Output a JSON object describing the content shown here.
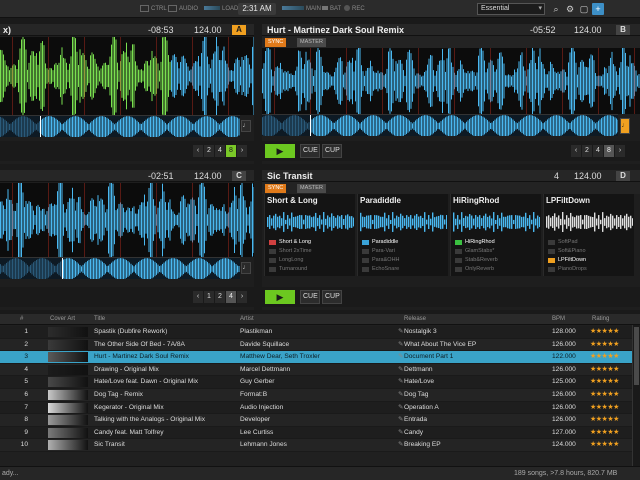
{
  "header": {
    "ctrl_label": "CTRL",
    "audio_label": "AUDIO",
    "load_label": "LOAD",
    "clock": "2:31 AM",
    "main_label": "MAIN",
    "bat_label": "BAT",
    "rec_label": "REC",
    "layout": "Essential"
  },
  "deck_a": {
    "title": "x)",
    "time": "-08:53",
    "bpm": "124.00",
    "letter": "A",
    "loop": [
      "2",
      "4",
      "8"
    ],
    "loop_active": "8"
  },
  "deck_b": {
    "title": "Hurt - Martinez Dark Soul Remix",
    "sync": "SYNC",
    "master": "MASTER",
    "time": "-05:52",
    "bpm": "124.00",
    "letter": "B",
    "play": "▶",
    "cue": "CUE",
    "cup": "CUP",
    "loop": [
      "2",
      "4",
      "8"
    ],
    "loop_active": "8"
  },
  "deck_c": {
    "time": "-02:51",
    "bpm": "124.00",
    "letter": "C",
    "loop": [
      "1",
      "2",
      "4"
    ],
    "loop_active": "4"
  },
  "deck_d": {
    "title": "Sic Transit",
    "sync": "SYNC",
    "master": "MASTER",
    "counter": "4",
    "bpm": "124.00",
    "letter": "D",
    "play": "▶",
    "cue": "CUE",
    "cup": "CUP",
    "slots": [
      {
        "title": "Short & Long",
        "items": [
          "Short & Long",
          "Short 2xTime",
          "LongLong",
          "Turnaround"
        ],
        "active": 0,
        "color": "#d04040"
      },
      {
        "title": "Paradiddle",
        "items": [
          "Paradiddle",
          "Para-Vari",
          "Para&OHH",
          "EchoSnare"
        ],
        "active": 0,
        "color": "#3aa3d8"
      },
      {
        "title": "HiRingRhod",
        "items": [
          "HiRingRhod",
          "GlamStabs*",
          "Stab&Reverb",
          "OnlyReverb"
        ],
        "active": 0,
        "color": "#3ac040"
      },
      {
        "title": "LPFiltDown",
        "items": [
          "SoftPad",
          "Soft&Piano",
          "LPFiltDown",
          "PianoDrops"
        ],
        "active": 2,
        "color": "#f0a020"
      }
    ]
  },
  "browser": {
    "columns": {
      "num": "#",
      "cover": "Cover Art",
      "title": "Title",
      "artist": "Artist",
      "release": "Release",
      "bpm": "BPM",
      "rating": "Rating"
    },
    "rows": [
      {
        "num": "1",
        "title": "Spastik (Dubfire Rework)",
        "artist": "Plastikman",
        "release": "Nostalgik 3",
        "bpm": "128.000",
        "rating": "★★★★★"
      },
      {
        "num": "2",
        "title": "The Other Side Of Bed - 7A/8A",
        "artist": "Davide Squillace",
        "release": "What About The Vice EP",
        "bpm": "126.000",
        "rating": "★★★★★"
      },
      {
        "num": "3",
        "title": "Hurt - Martinez Dark Soul Remix",
        "artist": "Matthew Dear, Seth Troxler",
        "release": "Document Part 1",
        "bpm": "122.000",
        "rating": "★★★★★"
      },
      {
        "num": "4",
        "title": "Drawing - Original Mix",
        "artist": "Marcel Dettmann",
        "release": "Dettmann",
        "bpm": "126.000",
        "rating": "★★★★★"
      },
      {
        "num": "5",
        "title": "Hate/Love feat. Dawn - Original Mix",
        "artist": "Guy Gerber",
        "release": "Hate/Love",
        "bpm": "125.000",
        "rating": "★★★★★"
      },
      {
        "num": "6",
        "title": "Dog Tag - Remix",
        "artist": "Format:B",
        "release": "Dog Tag",
        "bpm": "126.000",
        "rating": "★★★★★"
      },
      {
        "num": "7",
        "title": "Kegerator - Original Mix",
        "artist": "Audio Injection",
        "release": "Operation A",
        "bpm": "126.000",
        "rating": "★★★★★"
      },
      {
        "num": "8",
        "title": "Talking with the Analogs - Original Mix",
        "artist": "Developer",
        "release": "Entrada",
        "bpm": "126.000",
        "rating": "★★★★★"
      },
      {
        "num": "9",
        "title": "Candy feat. Matt Tolfrey",
        "artist": "Lee Curtiss",
        "release": "Candy",
        "bpm": "127.000",
        "rating": "★★★★★"
      },
      {
        "num": "10",
        "title": "Sic Transit",
        "artist": "Lehmann Jones",
        "release": "Breaking EP",
        "bpm": "124.000",
        "rating": "★★★★★"
      }
    ],
    "selected_index": 2
  },
  "status": {
    "left": "ady...",
    "right": "189 songs, >7.8 hours, 820.7 MB"
  },
  "colors": {
    "accent_blue": "#3aa3c8",
    "green": "#6cc820",
    "orange": "#f0a020",
    "wave_blue": "#4ab8f0",
    "wave_green": "#7ae050"
  }
}
